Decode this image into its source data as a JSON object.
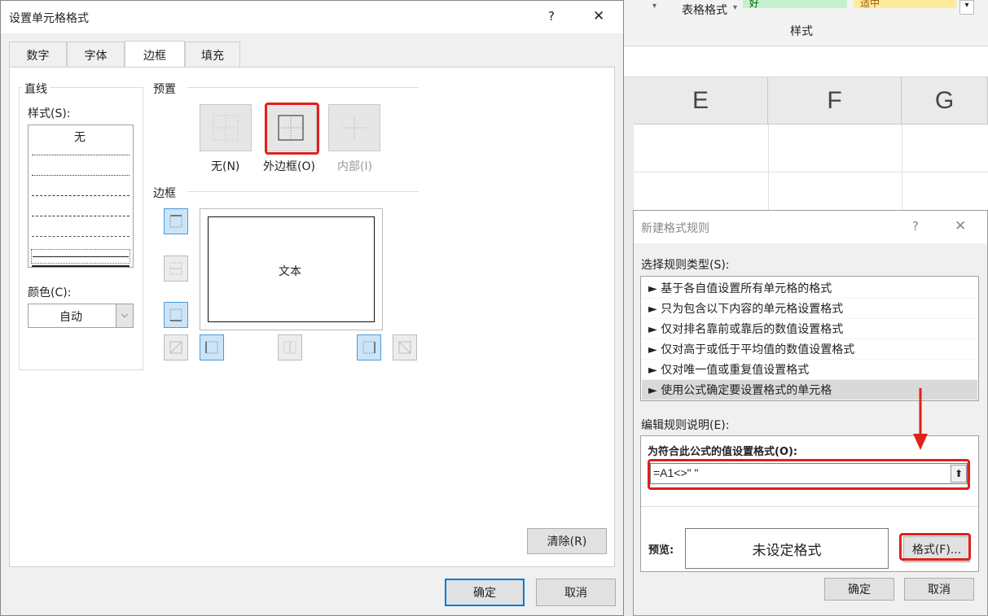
{
  "excel": {
    "ribbon_table_format": "表格格式",
    "ribbon_style_group": "样式",
    "ribbon_good": "好",
    "ribbon_neutral": "适中",
    "columns": [
      "E",
      "F",
      "G"
    ]
  },
  "format_cells": {
    "title": "设置单元格格式",
    "help": "?",
    "close": "✕",
    "tabs": [
      "数字",
      "字体",
      "边框",
      "填充"
    ],
    "line_group": "直线",
    "style_label": "样式(S):",
    "style_none": "无",
    "color_label": "颜色(C):",
    "color_value": "自动",
    "preset_group": "预置",
    "preset_none": "无(N)",
    "preset_outline": "外边框(O)",
    "preset_inside": "内部(I)",
    "border_group": "边框",
    "preview_text": "文本",
    "clear_button": "清除(R)",
    "ok_button": "确定",
    "cancel_button": "取消"
  },
  "new_rule": {
    "title": "新建格式规则",
    "help": "?",
    "close": "✕",
    "select_type_label": "选择规则类型(S):",
    "rule_types": [
      "► 基于各自值设置所有单元格的格式",
      "► 只为包含以下内容的单元格设置格式",
      "► 仅对排名靠前或靠后的数值设置格式",
      "► 仅对高于或低于平均值的数值设置格式",
      "► 仅对唯一值或重复值设置格式",
      "► 使用公式确定要设置格式的单元格"
    ],
    "edit_desc_label": "编辑规则说明(E):",
    "formula_label": "为符合此公式的值设置格式(O):",
    "formula_value": "=A1<>\" \"",
    "preview_label": "预览:",
    "preview_text": "未设定格式",
    "format_button": "格式(F)...",
    "ok_button": "确定",
    "cancel_button": "取消"
  },
  "colors": {
    "highlight_red": "#e0201b",
    "accent_blue": "#0078d7",
    "good_fill": "#c6efce",
    "neutral_fill": "#ffeb9c"
  }
}
